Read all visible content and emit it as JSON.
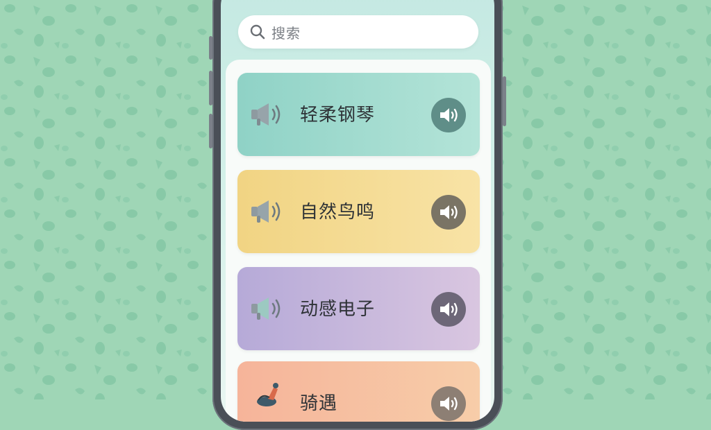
{
  "search": {
    "placeholder": "搜索"
  },
  "cards": [
    {
      "title": "轻柔钢琴",
      "accent": "#8fd2c6"
    },
    {
      "title": "自然鸟鸣",
      "accent": "#f1d483"
    },
    {
      "title": "动感电子",
      "accent": "#b6aad8"
    },
    {
      "title": "骑遇",
      "accent": "#f6b49a"
    }
  ],
  "icons": {
    "search": "search-icon",
    "megaphone": "megaphone-icon",
    "speaker": "speaker-icon"
  }
}
